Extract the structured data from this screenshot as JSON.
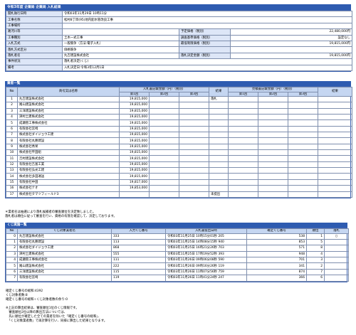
{
  "page": {
    "title": "令和3年度 企業局 企業局 入札結果"
  },
  "info": {
    "rows": [
      {
        "label": "開札執行日時",
        "value": "令和03年11月29日 10時11分"
      },
      {
        "label": "工事名称",
        "value": "松村8丁目(95)地内配水管改良工事"
      },
      {
        "label": "工事場所",
        "value": ""
      }
    ],
    "split_rows": [
      {
        "l1": "路河川等",
        "v1": "",
        "l2": "予定価格（税別）",
        "v2": "22,480,000円"
      },
      {
        "l1": "工事種別",
        "v1": "土木一式工事",
        "l2": "調査基準価格（税別）",
        "v2": "設定なし"
      },
      {
        "l1": "入札方式",
        "v1": "一般競争（方法:電子入札）",
        "l2": "最低制限価格（税別）",
        "v2": "19,815,000円"
      },
      {
        "l1": "落札方式区分",
        "v1": "価格競争",
        "l2": "",
        "v2": ""
      },
      {
        "l1": "落札者名",
        "v1": "丸吉建設株式会社",
        "l2": "落札決定金額（税別）",
        "v2": "19,815,000円"
      }
    ],
    "rows2": [
      {
        "label": "事件状況",
        "value": "落札者決定(くじ)"
      },
      {
        "label": "備考",
        "value": "入札決定日:令和3年12月1日"
      }
    ]
  },
  "bidders": {
    "section": "業者一覧",
    "headers": {
      "no": "No",
      "name": "商号又は名称",
      "bid_group": "入札書記載金額（円）（税別）",
      "r1": "第1回",
      "r2": "第2回",
      "r3": "第3回",
      "result": "結果",
      "est_group": "見積書記載金額（円）（税別）",
      "e1": "第1回",
      "e2": "第2回",
      "e3": "第3回",
      "result2": "結果"
    },
    "rows": [
      {
        "no": "1",
        "name": "丸吉建設株式会社",
        "r1": "19,815,000",
        "result": "落札"
      },
      {
        "no": "2",
        "name": "尾山建設株式会社",
        "r1": "19,815,000",
        "result": ""
      },
      {
        "no": "3",
        "name": "三洋建設株式会社",
        "r1": "19,815,000",
        "result": ""
      },
      {
        "no": "4",
        "name": "津村土建株式会社",
        "r1": "19,815,000",
        "result": ""
      },
      {
        "no": "5",
        "name": "成瀬管工事株式会社",
        "r1": "19,815,000",
        "result": ""
      },
      {
        "no": "6",
        "name": "有限会社宮崎",
        "r1": "19,815,000",
        "result": ""
      },
      {
        "no": "7",
        "name": "株式会社ダイジョウ工建",
        "r1": "19,815,000",
        "result": ""
      },
      {
        "no": "8",
        "name": "有限会社丸勝建設",
        "r1": "19,815,000",
        "result": ""
      },
      {
        "no": "9",
        "name": "株式会社秀栄",
        "r1": "19,815,000",
        "result": ""
      },
      {
        "no": "10",
        "name": "株式会社平田組",
        "r1": "19,815,000",
        "result": ""
      },
      {
        "no": "11",
        "name": "吉村建設株式会社",
        "r1": "19,815,000",
        "result": ""
      },
      {
        "no": "12",
        "name": "有限会社吉富工業",
        "r1": "19,815,000",
        "result": ""
      },
      {
        "no": "13",
        "name": "有限会社弘光工建",
        "r1": "19,815,000",
        "result": ""
      },
      {
        "no": "14",
        "name": "株式会社多田運送",
        "r1": "19,815,000",
        "result": ""
      },
      {
        "no": "15",
        "name": "有限会社中田",
        "r1": "19,817,000",
        "result": ""
      },
      {
        "no": "16",
        "name": "株式会社ナオ",
        "r1": "19,853,000",
        "result": ""
      },
      {
        "no": "17",
        "name": "株式会社タマツフィールド3",
        "r1": "",
        "result": "未提出"
      }
    ]
  },
  "notes": {
    "line1": "＊業者名は抽選により落札候補者の審査順位を決定致しました。",
    "line2": "落札者は順位に従って審査を行い、資格の有無を確認して、決定しております。"
  },
  "lottery": {
    "section": "くじ実施一覧",
    "headers": {
      "no": "No",
      "name": "くじ対象業者名",
      "input": "入力くじ番号",
      "time": "入札書提出日時",
      "confirmed": "確定くじ番号",
      "rank": "順位",
      "result": "落札"
    },
    "rows": [
      {
        "no": "0",
        "name": "丸吉建設株式会社",
        "input": "333",
        "time": "令和03年11月25日 10時15分01秒 205",
        "confirmed": "538",
        "rank": "1",
        "result": "○"
      },
      {
        "no": "1",
        "name": "有限会社丸勝建設",
        "input": "113",
        "time": "令和03年11月25日 14時08分15秒 940",
        "confirmed": "853",
        "rank": "5",
        "result": ""
      },
      {
        "no": "2",
        "name": "株式会社ダイジョウ工建",
        "input": "868",
        "time": "令和03年11月25日 16時21分26秒 703",
        "confirmed": "571",
        "rank": "8",
        "result": ""
      },
      {
        "no": "3",
        "name": "津村土建株式会社",
        "input": "555",
        "time": "令和03年11月25日 17時19分52秒 393",
        "confirmed": "948",
        "rank": "4",
        "result": ""
      },
      {
        "no": "4",
        "name": "成瀬管工事株式会社",
        "input": "111",
        "time": "令和03年11月26日 09時06分08秒 590",
        "confirmed": "701",
        "rank": "3",
        "result": ""
      },
      {
        "no": "5",
        "name": "尾山建設株式会社",
        "input": "222",
        "time": "令和03年11月26日 09時16分26秒 119",
        "confirmed": "341",
        "rank": "2",
        "result": ""
      },
      {
        "no": "6",
        "name": "三洋建設株式会社",
        "input": "115",
        "time": "令和03年11月26日 11時07分56秒 759",
        "confirmed": "874",
        "rank": "7",
        "result": ""
      },
      {
        "no": "7",
        "name": "有限会社宮崎",
        "input": "119",
        "time": "令和03年11月26日 11時41分24秒 247",
        "confirmed": "366",
        "rank": "6",
        "result": ""
      }
    ]
  },
  "footer": {
    "line1": "確定くじ番号の総和:4392",
    "line2": "くじ対象者数:8",
    "line3": "確定くじ番号の総和÷くじ対象者数の余り:0",
    "note1": "※上記の算出結果は、審査順位1位のくじ情報です。",
    "note2": "　審査順位2位以降の算出方法については、",
    "note3": "　先に順位が確定した全ての業者を除いた「確定くじ番号の総和」、",
    "note4": "　「くじ対象業者数」で再計算を行い、同様に算出した結果となります。"
  }
}
